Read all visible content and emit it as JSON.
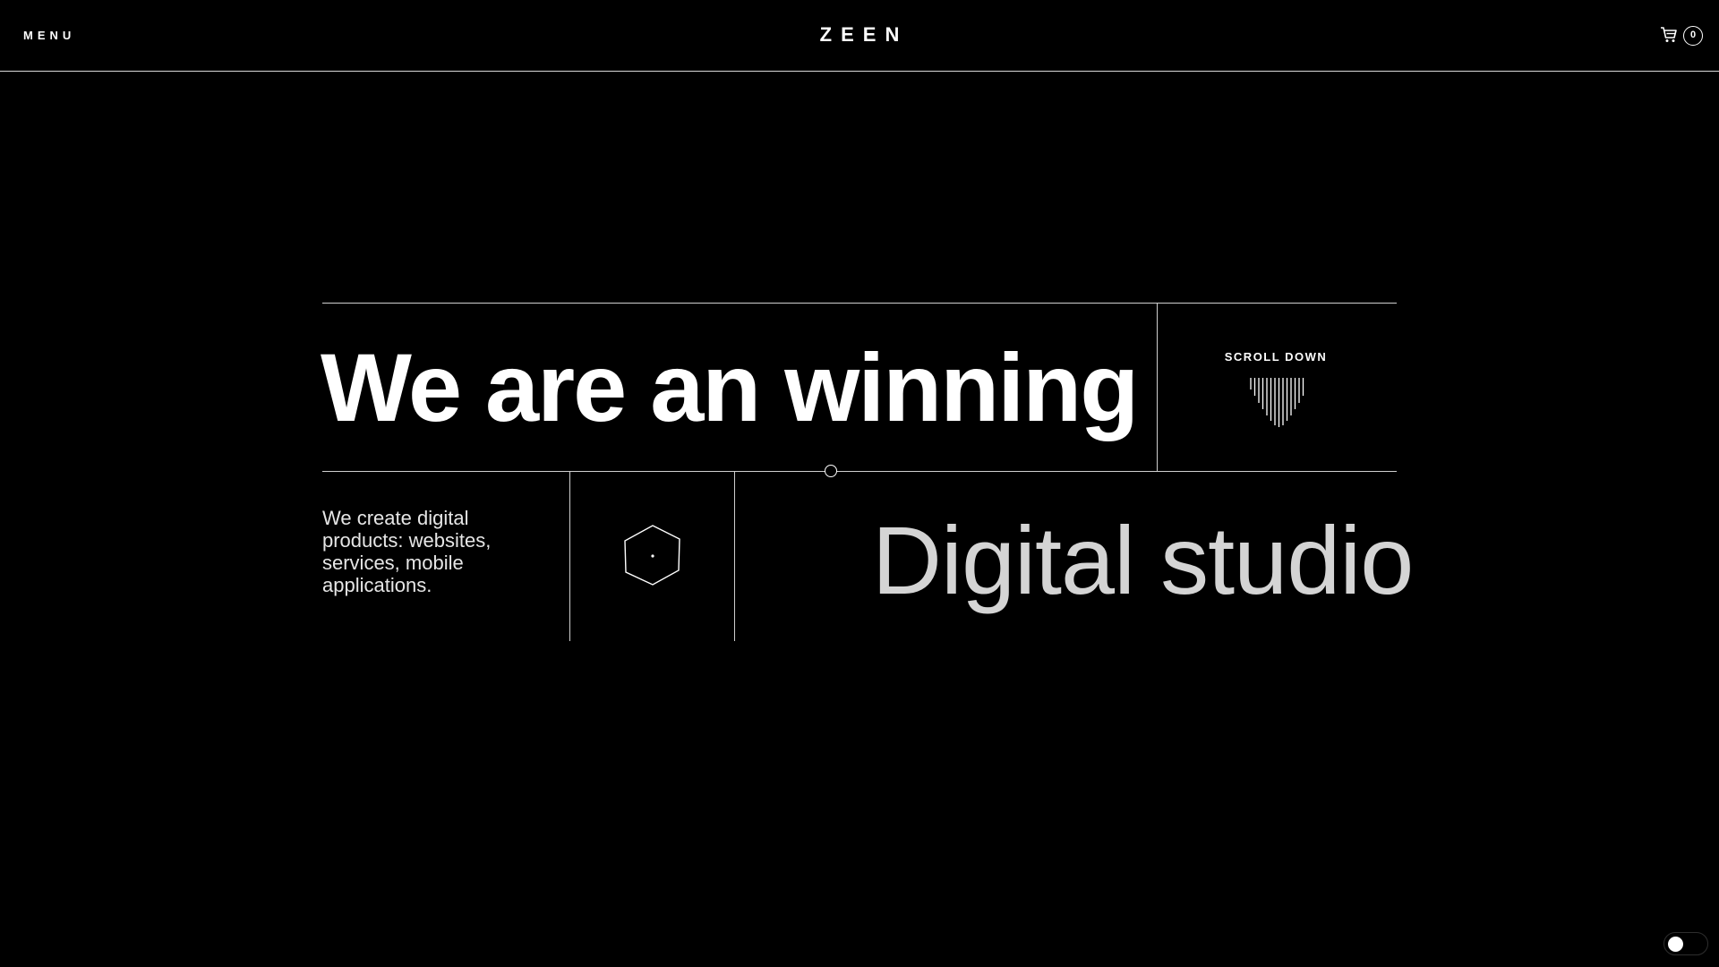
{
  "header": {
    "menu_label": "MENU",
    "logo": "ZEEN",
    "cart": {
      "icon": "cart-icon",
      "count": "0"
    }
  },
  "hero": {
    "headline": "We are an winning",
    "scroll_down_label": "SCROLL DOWN",
    "scroll_icon": "scroll-down-arrows-icon",
    "tagline": "We create digital products: websites, services, mobile applications.",
    "decor_icon": "hexagon-icon",
    "subheadline": "Digital studio"
  },
  "theme_toggle": {
    "state": "dark"
  },
  "colors": {
    "background": "#000000",
    "text_primary": "#ffffff",
    "text_secondary": "#d4d4d4",
    "lines": "#cfcfcf"
  }
}
